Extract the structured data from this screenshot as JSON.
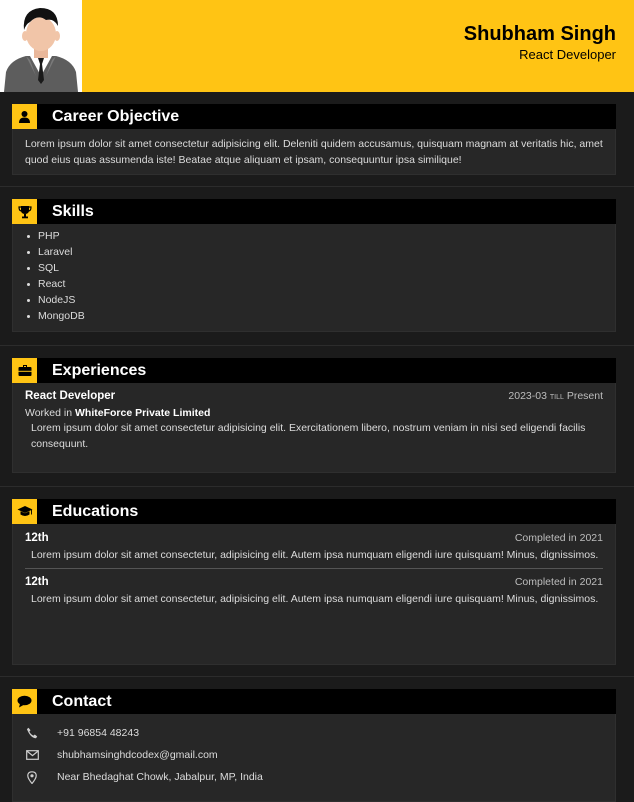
{
  "header": {
    "name": "Shubham Singh",
    "role": "React Developer"
  },
  "career": {
    "title": "Career Objective",
    "text": "Lorem ipsum dolor sit amet consectetur adipisicing elit. Deleniti quidem accusamus, quisquam magnam at veritatis hic, amet quod eius quas assumenda iste! Beatae atque aliquam et ipsam, consequuntur ipsa similique!"
  },
  "skills": {
    "title": "Skills",
    "items": [
      "PHP",
      "Laravel",
      "SQL",
      "React",
      "NodeJS",
      "MongoDB"
    ]
  },
  "experiences": {
    "title": "Experiences",
    "items": [
      {
        "role": "React Developer",
        "start": "2023-03",
        "till": "till",
        "end": "Present",
        "worked_in_label": "Worked in",
        "company": "WhiteForce Private Limited",
        "description": "Lorem ipsum dolor sit amet consectetur adipisicing elit. Exercitationem libero, nostrum veniam in nisi sed eligendi facilis consequunt."
      }
    ]
  },
  "educations": {
    "title": "Educations",
    "items": [
      {
        "degree": "12th",
        "completed": "Completed in 2021",
        "description": "Lorem ipsum dolor sit amet consectetur, adipisicing elit. Autem ipsa numquam eligendi iure quisquam! Minus, dignissimos."
      },
      {
        "degree": "12th",
        "completed": "Completed in 2021",
        "description": "Lorem ipsum dolor sit amet consectetur, adipisicing elit. Autem ipsa numquam eligendi iure quisquam! Minus, dignissimos."
      }
    ]
  },
  "contact": {
    "title": "Contact",
    "phone": "+91 96854 48243",
    "email": "shubhamsinghdcodex@gmail.com",
    "address": "Near Bhedaghat Chowk, Jabalpur, MP, India"
  },
  "colors": {
    "accent": "#ffc414",
    "background": "#1b1b1b",
    "card": "#272727",
    "heading_bar": "#000000"
  },
  "icons": {
    "career": "user-icon",
    "skills": "trophy-icon",
    "experiences": "briefcase-icon",
    "educations": "graduation-cap-icon",
    "contact": "speech-bubble-icon",
    "phone": "phone-icon",
    "email": "envelope-icon",
    "address": "map-pin-icon"
  }
}
